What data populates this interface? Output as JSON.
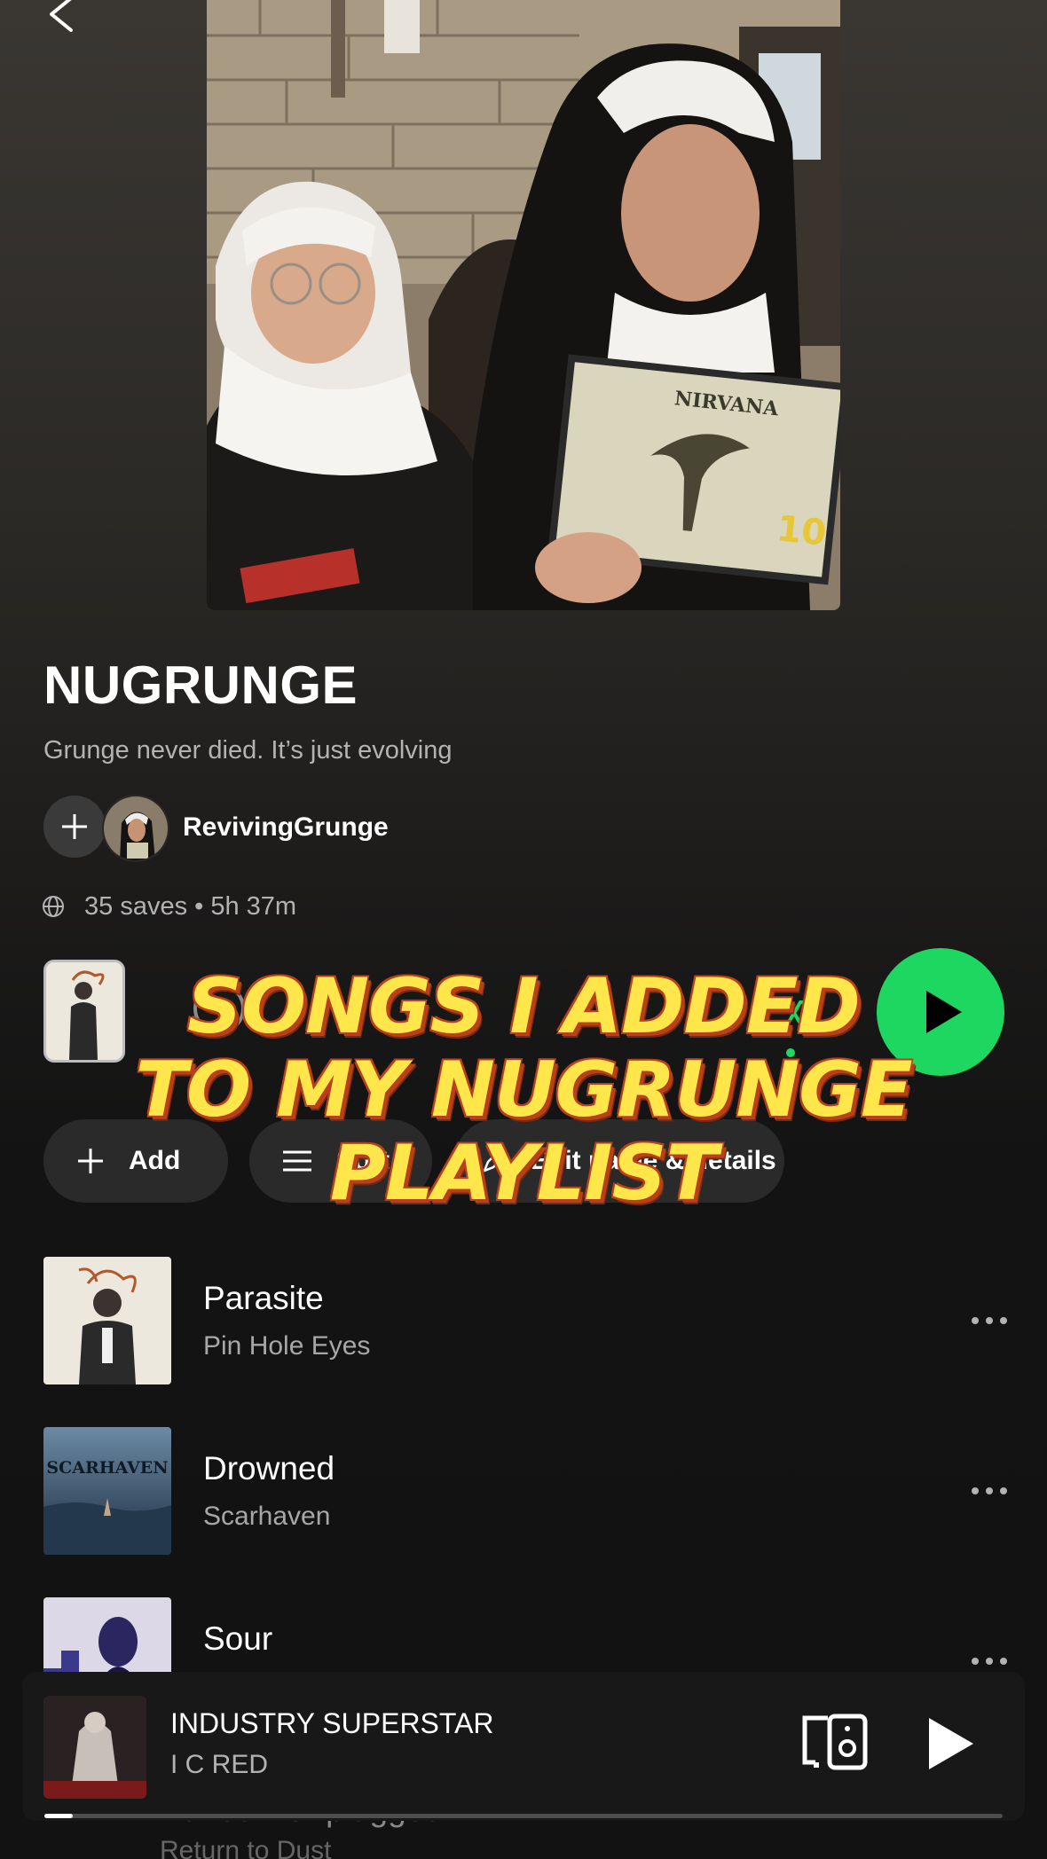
{
  "playlist": {
    "title": "NUGRUNGE",
    "description": "Grunge never died. It’s just evolving",
    "owner": "RevivingGrunge",
    "meta": "35 saves • 5h 37m"
  },
  "actions": {
    "add_label": "Add",
    "sort_label": "Sort",
    "edit_label": "Edit name & details"
  },
  "overlay": {
    "caption_line1": "SONGS I ADDED",
    "caption_line2": "TO MY NUGRUNGE",
    "caption_line3": "PLAYLIST"
  },
  "tracks": [
    {
      "title": "Parasite",
      "artist": "Pin Hole Eyes"
    },
    {
      "title": "Drowned",
      "artist": "Scarhaven",
      "art_text": "SCARHAVEN"
    },
    {
      "title": "Sour",
      "artist": ""
    },
    {
      "title": "Buried - Unplugged",
      "artist": "Return to Dust"
    }
  ],
  "now_playing": {
    "title": "INDUSTRY SUPERSTAR",
    "artist": "I C RED",
    "progress": 0.03
  },
  "colors": {
    "accent_green": "#1ed760",
    "caption_yellow": "#ffe64a",
    "caption_outline": "#b8401a"
  },
  "icons": {
    "back": "chevron-left-icon",
    "add_owner": "plus-icon",
    "globe": "globe-icon",
    "play": "play-icon",
    "add": "plus-icon",
    "sort": "list-icon",
    "more": "more-icon",
    "devices": "devices-icon"
  }
}
